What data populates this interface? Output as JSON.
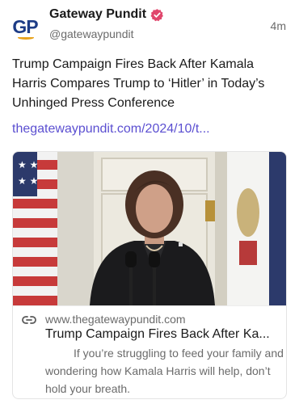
{
  "author": {
    "avatar_text_g": "G",
    "avatar_text_p": "P",
    "display_name": "Gateway Pundit",
    "handle": "@gatewaypundit",
    "verified_icon": "verified-badge-icon",
    "verified_color": "#e0466c"
  },
  "post": {
    "time": "4m",
    "text": "Trump Campaign Fires Back After Kamala Harris Compares Trump to ‘Hitler’ in Today’s Unhinged Press Conference",
    "link_text": "thegatewaypundit.com/2024/10/t...",
    "link_color": "#5b4fd1"
  },
  "card": {
    "domain": "www.thegatewaypundit.com",
    "title": "Trump Campaign Fires Back After Ka...",
    "description": "If you’re struggling to feed your family and wondering how Kamala Harris will help, don’t hold your breath.",
    "link_icon": "link-chain-icon"
  }
}
